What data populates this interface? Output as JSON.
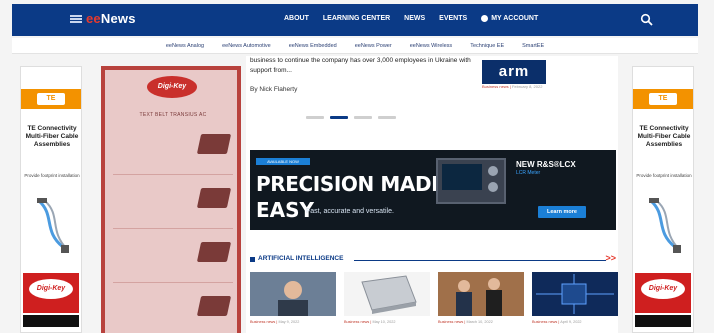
{
  "header": {
    "logo": {
      "prefix": "ee",
      "suffix": "News"
    },
    "nav": [
      "ABOUT",
      "LEARNING CENTER",
      "NEWS",
      "EVENTS"
    ],
    "account_label": "MY ACCOUNT"
  },
  "subnav": [
    "eeNews Analog",
    "eeNews Automotive",
    "eeNews Embedded",
    "eeNews Power",
    "eeNews Wireless",
    "Technique EE",
    "SmartEE"
  ],
  "left_ad": {
    "brand": "TE",
    "title": "TE Connectivity Multi-Fiber Cable Assemblies",
    "subtitle": "Provide footprint installation",
    "distributor": "Digi-Key"
  },
  "right_ad": {
    "brand": "TE",
    "title": "TE Connectivity Multi-Fiber Cable Assemblies",
    "subtitle": "Provide footprint installation",
    "distributor": "Digi-Key"
  },
  "red_sidebar": {
    "logo": "Digi-Key",
    "heading": "TEXT BELT TRANSIUS AC"
  },
  "article": {
    "snippet": "business to continue the company has over 3,000 employees in Ukraine with support from...",
    "author": "By Nick Flaherty"
  },
  "side_story": {
    "thumb_text": "arm",
    "meta_label": "Business news",
    "meta_date": "February 8, 2022"
  },
  "banner": {
    "tag": "AVAILABLE NOW",
    "headline_1": "PRECISION MADE",
    "headline_2": "EASY",
    "tagline": "Fast, accurate and versatile.",
    "new_title": "NEW R&S®LCX",
    "new_sub": "LCR Meter",
    "cta": "Learn more"
  },
  "section": {
    "title": "ARTIFICIAL INTELLIGENCE",
    "more": ">>"
  },
  "thumbs": [
    {
      "label": "Business news",
      "date": "May 9, 2022"
    },
    {
      "label": "Business news",
      "date": "May 10, 2022"
    },
    {
      "label": "Business news",
      "date": "March 10, 2022"
    },
    {
      "label": "Business news",
      "date": "April 9, 2022"
    }
  ],
  "colors": {
    "nav_bg": "#0b3a86",
    "accent_red": "#e63a2e",
    "te_orange": "#f39200",
    "digikey_red": "#cf1f1f",
    "highlight_red": "#b8423d"
  }
}
